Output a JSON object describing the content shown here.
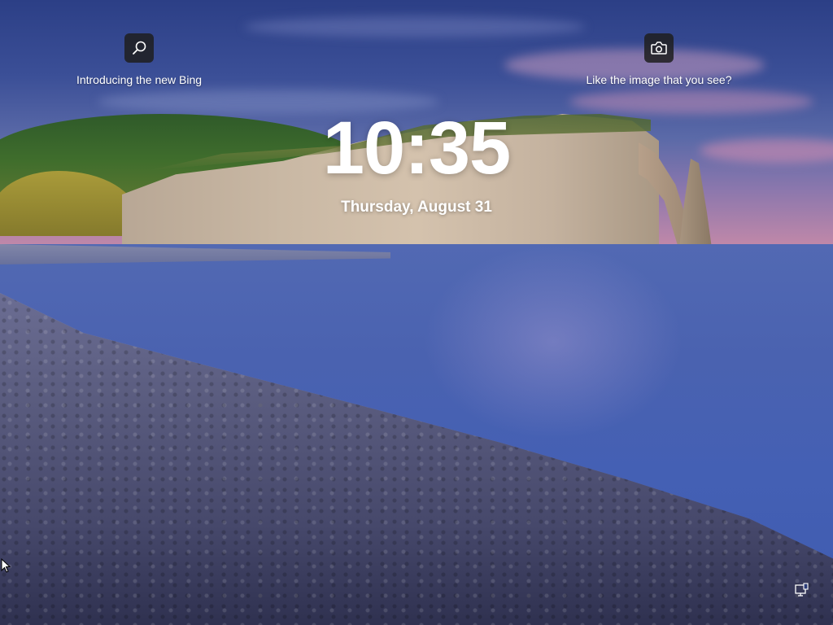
{
  "lockscreen": {
    "clock": "10:35",
    "date": "Thursday, August 31"
  },
  "tiles": {
    "bing": {
      "label": "Introducing the new Bing",
      "icon": "search-icon"
    },
    "spotlight": {
      "label": "Like the image that you see?",
      "icon": "camera-icon"
    }
  },
  "system": {
    "network_icon": "network-icon",
    "cursor_icon": "mouse-pointer-icon"
  }
}
